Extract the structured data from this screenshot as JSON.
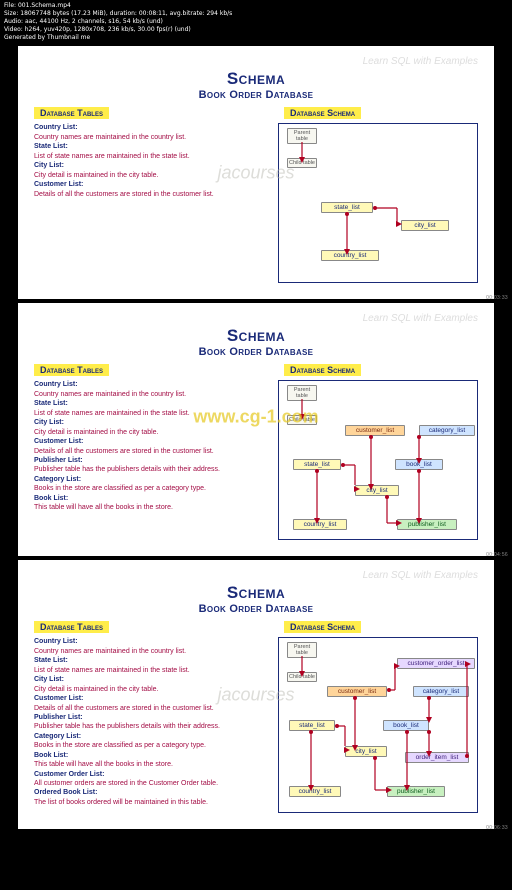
{
  "meta": {
    "file_line": "File: 001.Schema.mp4",
    "size_line": "Size: 18067748 bytes (17.23 MiB), duration: 00:08:11, avg.bitrate: 294 kb/s",
    "audio_line": "Audio: aac, 44100 Hz, 2 channels, s16, 54 kb/s (und)",
    "video_line": "Video: h264, yuv420p, 1280x708, 236 kb/s, 30.00 fps(r) (und)",
    "gen_line": "Generated by Thumbnail me"
  },
  "common": {
    "tagline": "Learn SQL with Examples",
    "schema": "Schema",
    "subtitle": "Book Order Database",
    "tables_label": "Database Tables",
    "schema_label": "Database Schema",
    "legend_parent": "Parent table",
    "legend_child": "Child table"
  },
  "watermark1": "jacourses",
  "watermark2": "www.cg-1.com",
  "frames": [
    {
      "timestamp": "00:03:33",
      "tables": [
        {
          "name": "Country List:",
          "desc": "Country names are maintained in the country list."
        },
        {
          "name": "State List:",
          "desc": "List of state names are maintained in the state list."
        },
        {
          "name": "City List:",
          "desc": "City detail is maintained in the city table."
        },
        {
          "name": "Customer List:",
          "desc": "Details of all the customers are stored in the customer list."
        }
      ],
      "nodes": {
        "state": "state_list",
        "city": "city_list",
        "country": "country_list"
      }
    },
    {
      "timestamp": "00:04:56",
      "tables": [
        {
          "name": "Country List:",
          "desc": "Country names are maintained in the country list."
        },
        {
          "name": "State List:",
          "desc": "List of state names are maintained in the state list."
        },
        {
          "name": "City List:",
          "desc": "City detail is maintained in the city table."
        },
        {
          "name": "Customer List:",
          "desc": "Details of all the customers are stored in the customer list."
        },
        {
          "name": "Publisher List:",
          "desc": "Publisher table has the publishers details with their address."
        },
        {
          "name": "Category List:",
          "desc": "Books in the store are classified as per a category type."
        },
        {
          "name": "Book List:",
          "desc": "This table will have all the books in the store."
        }
      ],
      "nodes": {
        "state": "state_list",
        "city": "city_list",
        "country": "country_list",
        "customer": "customer_list",
        "category": "category_list",
        "book": "book_list",
        "publisher": "publisher_list"
      }
    },
    {
      "timestamp": "00:06:33",
      "tables": [
        {
          "name": "Country List:",
          "desc": "Country names are maintained in the country list."
        },
        {
          "name": "State List:",
          "desc": "List of state names are maintained in the state list."
        },
        {
          "name": "City List:",
          "desc": "City detail is maintained in the city table."
        },
        {
          "name": "Customer List:",
          "desc": "Details of all the customers are stored in the customer list."
        },
        {
          "name": "Publisher List:",
          "desc": "Publisher table has the publishers details with their address."
        },
        {
          "name": "Category List:",
          "desc": "Books in the store are classified as per a category type."
        },
        {
          "name": "Book List:",
          "desc": "This table will have all the books in the store."
        },
        {
          "name": "Customer Order List:",
          "desc": "All customer orders are stored in the Customer Order table."
        },
        {
          "name": "Ordered Book List:",
          "desc": "The list of books ordered will be maintained in this table."
        }
      ],
      "nodes": {
        "state": "state_list",
        "city": "city_list",
        "country": "country_list",
        "customer": "customer_list",
        "category": "category_list",
        "book": "book_list",
        "publisher": "publisher_list",
        "corder": "customer_order_list",
        "oitem": "order_item_list"
      }
    }
  ]
}
